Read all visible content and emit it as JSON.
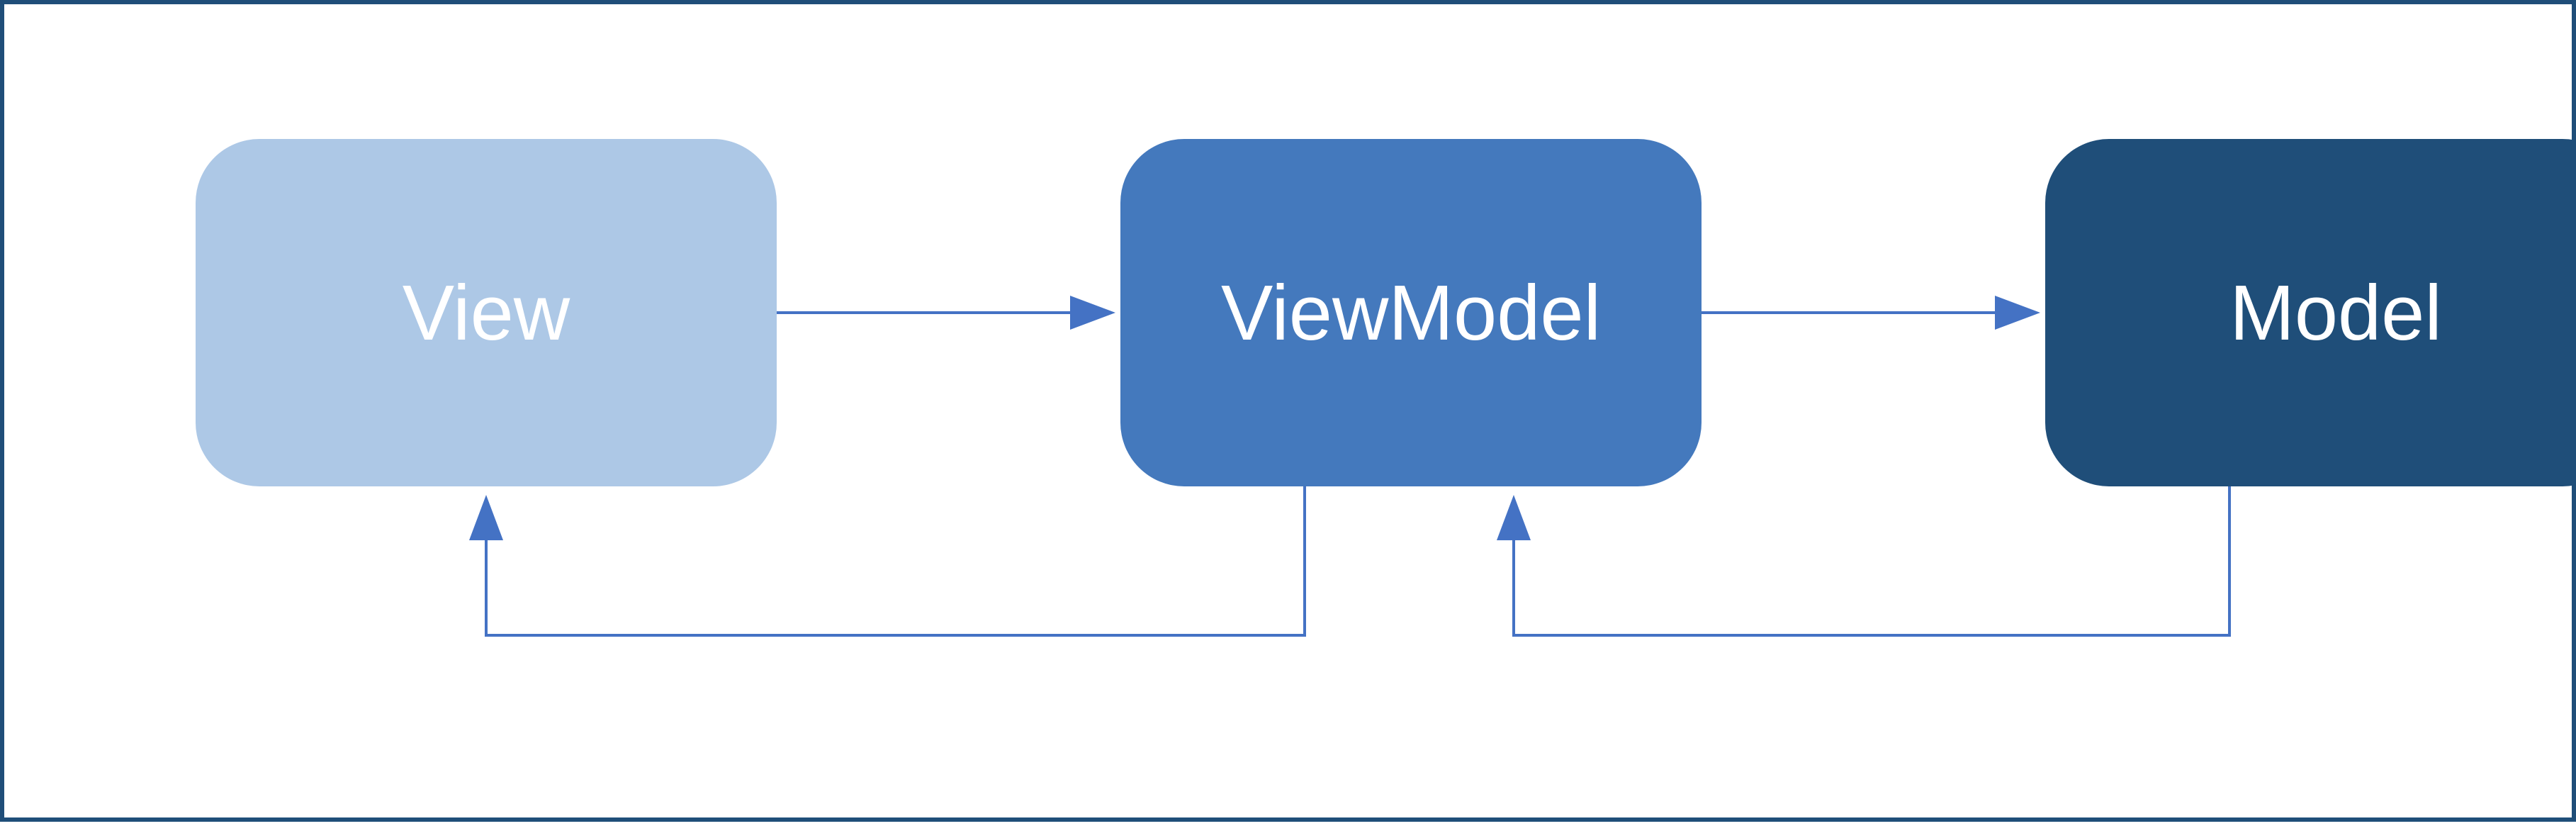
{
  "nodes": {
    "view": {
      "label": "View",
      "color": "#adc8e6"
    },
    "viewmodel": {
      "label": "ViewModel",
      "color": "#4479bd"
    },
    "model": {
      "label": "Model",
      "color": "#1f4e79"
    }
  },
  "edges": [
    {
      "from": "view",
      "to": "viewmodel",
      "style": "straight"
    },
    {
      "from": "viewmodel",
      "to": "model",
      "style": "straight"
    },
    {
      "from": "viewmodel",
      "to": "view",
      "style": "elbow-bottom"
    },
    {
      "from": "model",
      "to": "viewmodel",
      "style": "elbow-bottom"
    }
  ],
  "arrow_color": "#4472c4",
  "border_color": "#1f4e79"
}
